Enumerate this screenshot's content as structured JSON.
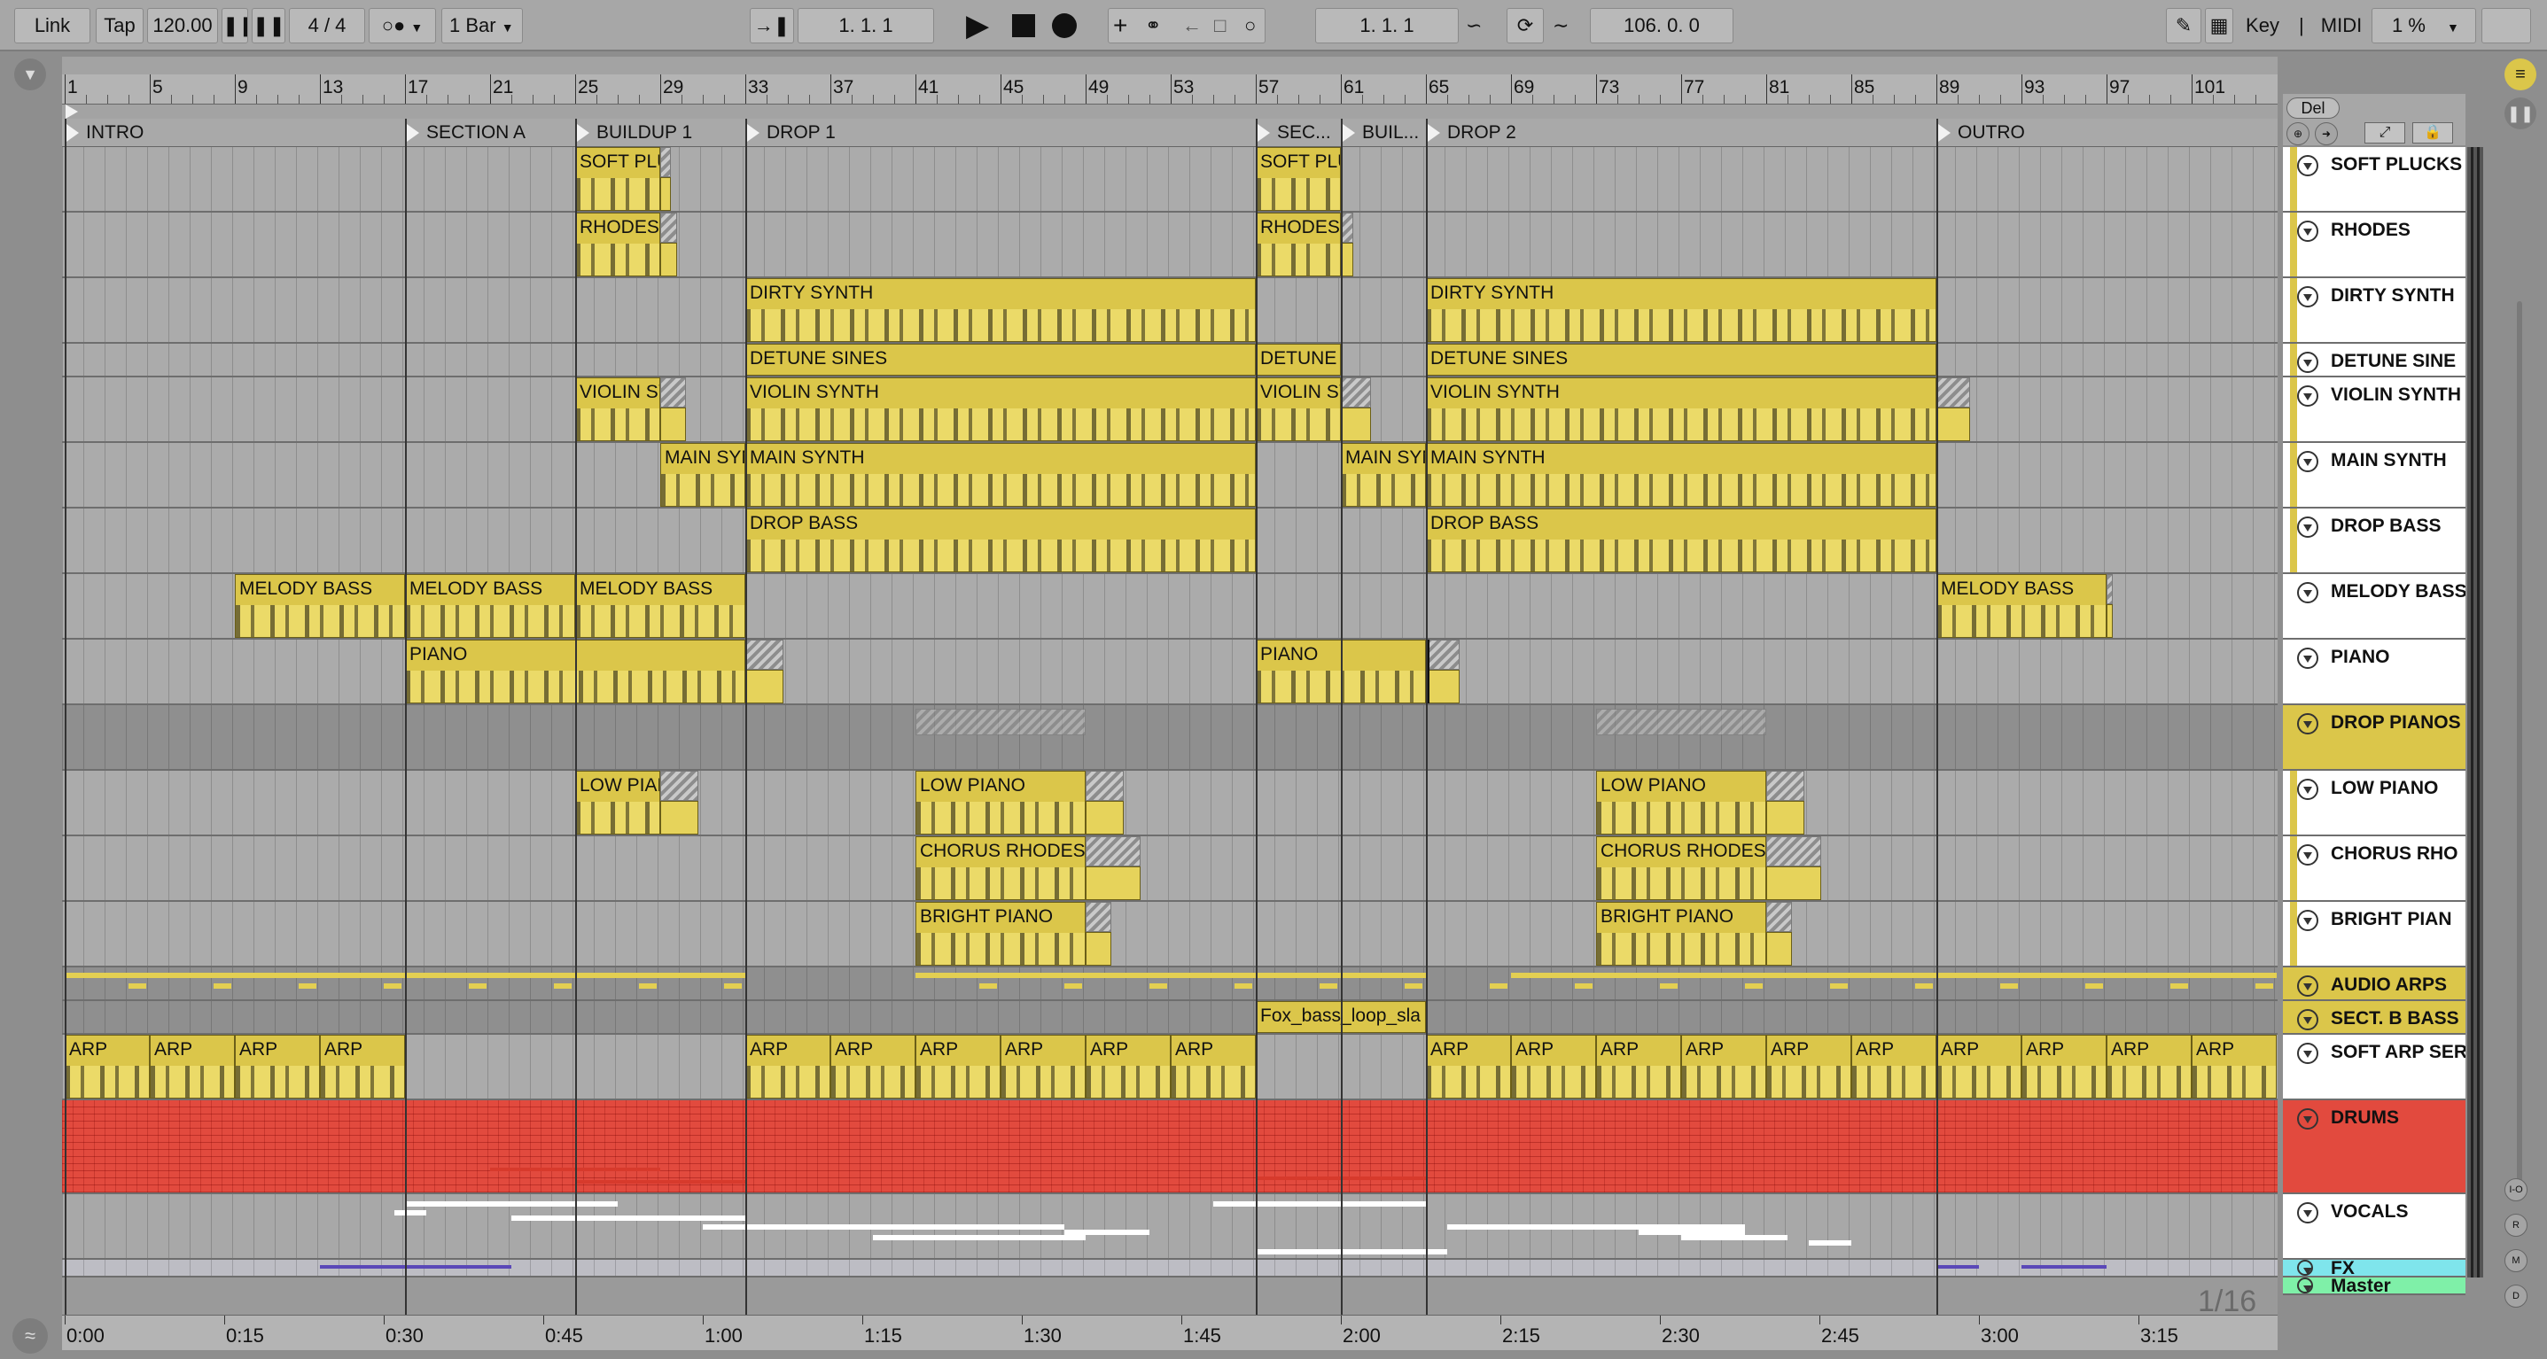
{
  "toolbar": {
    "link": "Link",
    "tap": "Tap",
    "tempo": "120.00",
    "signature": "4 / 4",
    "quantize": "1 Bar",
    "arrangement_position": "1.   1.   1",
    "loop_start": "1.   1.   1",
    "loop_length": "106.   0.   0",
    "key": "Key",
    "midi": "MIDI",
    "cpu": "1 %"
  },
  "del_label": "Del",
  "ruler": {
    "bars": [
      "1",
      "5",
      "9",
      "13",
      "17",
      "21",
      "25",
      "29",
      "33",
      "37",
      "41",
      "45",
      "49",
      "53",
      "57",
      "61",
      "65",
      "69",
      "73",
      "77",
      "81",
      "85",
      "89",
      "93",
      "97",
      "101"
    ]
  },
  "locators": [
    {
      "name": "INTRO",
      "bar": 1
    },
    {
      "name": "SECTION A",
      "bar": 17
    },
    {
      "name": "BUILDUP 1",
      "bar": 25
    },
    {
      "name": "DROP 1",
      "bar": 33
    },
    {
      "name": "SEC...",
      "bar": 57
    },
    {
      "name": "BUIL...",
      "bar": 61
    },
    {
      "name": "DROP 2",
      "bar": 65
    },
    {
      "name": "OUTRO",
      "bar": 89
    }
  ],
  "tracks": [
    {
      "name": "SOFT PLUCKS",
      "kind": "midi",
      "clips": [
        {
          "label": "SOFT PLU",
          "start": 25,
          "end": 29,
          "tail": 29.5
        },
        {
          "label": "SOFT PLU",
          "start": 57,
          "end": 61
        }
      ]
    },
    {
      "name": "RHODES",
      "kind": "midi",
      "clips": [
        {
          "label": "RHODES",
          "start": 25,
          "end": 29,
          "tail": 29.8
        },
        {
          "label": "RHODES",
          "start": 57,
          "end": 61,
          "tail": 61.6
        }
      ]
    },
    {
      "name": "DIRTY SYNTH",
      "kind": "midi",
      "clips": [
        {
          "label": "DIRTY SYNTH",
          "start": 33,
          "end": 57
        },
        {
          "label": "DIRTY SYNTH",
          "start": 65,
          "end": 89
        }
      ]
    },
    {
      "name": "DETUNE SINE",
      "kind": "midi",
      "clips": [
        {
          "label": "DETUNE SINES",
          "start": 33,
          "end": 57
        },
        {
          "label": "DETUNE S",
          "start": 57,
          "end": 61
        },
        {
          "label": "DETUNE SINES",
          "start": 65,
          "end": 89
        }
      ]
    },
    {
      "name": "VIOLIN SYNTH",
      "kind": "midi",
      "clips": [
        {
          "label": "VIOLIN SY",
          "start": 25,
          "end": 29,
          "tail": 30.2
        },
        {
          "label": "VIOLIN SYNTH",
          "start": 33,
          "end": 57
        },
        {
          "label": "VIOLIN SY",
          "start": 57,
          "end": 61,
          "tail": 62.4
        },
        {
          "label": "VIOLIN SYNTH",
          "start": 65,
          "end": 89,
          "tail": 90.6
        }
      ]
    },
    {
      "name": "MAIN SYNTH",
      "kind": "midi",
      "clips": [
        {
          "label": "MAIN SYN",
          "start": 29,
          "end": 33
        },
        {
          "label": "MAIN SYNTH",
          "start": 33,
          "end": 57
        },
        {
          "label": "MAIN SYN",
          "start": 61,
          "end": 65
        },
        {
          "label": "MAIN SYNTH",
          "start": 65,
          "end": 89
        }
      ]
    },
    {
      "name": "DROP BASS",
      "kind": "midi",
      "clips": [
        {
          "label": "DROP BASS",
          "start": 33,
          "end": 57
        },
        {
          "label": "DROP BASS",
          "start": 65,
          "end": 89
        }
      ]
    },
    {
      "name": "MELODY BASS",
      "kind": "midi",
      "clips": [
        {
          "label": "MELODY BASS",
          "start": 9,
          "end": 17
        },
        {
          "label": "MELODY BASS",
          "start": 17,
          "end": 25
        },
        {
          "label": "MELODY BASS",
          "start": 25,
          "end": 33
        },
        {
          "label": "MELODY BASS",
          "start": 89,
          "end": 97,
          "tail": 97.3
        }
      ]
    },
    {
      "name": "PIANO",
      "kind": "midi",
      "clips": [
        {
          "label": "PIANO",
          "start": 17,
          "end": 33,
          "tail": 34.8
        },
        {
          "label": "PIANO",
          "start": 57,
          "end": 65,
          "tail": 66.6
        }
      ]
    },
    {
      "name": "DROP PIANOS",
      "kind": "group",
      "clips": []
    },
    {
      "name": "LOW PIANO",
      "kind": "midi",
      "clips": [
        {
          "label": "LOW PIAN",
          "start": 25,
          "end": 29,
          "tail": 30.8
        },
        {
          "label": "LOW PIANO",
          "start": 41,
          "end": 49,
          "tail": 50.8
        },
        {
          "label": "LOW PIANO",
          "start": 73,
          "end": 81,
          "tail": 82.8
        }
      ]
    },
    {
      "name": "CHORUS RHO",
      "kind": "midi",
      "clips": [
        {
          "label": "CHORUS RHODES",
          "start": 41,
          "end": 49,
          "tail": 51.6
        },
        {
          "label": "CHORUS RHODES",
          "start": 73,
          "end": 81,
          "tail": 83.6
        }
      ]
    },
    {
      "name": "BRIGHT PIAN",
      "kind": "midi",
      "clips": [
        {
          "label": "BRIGHT PIANO",
          "start": 41,
          "end": 49,
          "tail": 50.2
        },
        {
          "label": "BRIGHT PIANO",
          "start": 73,
          "end": 81,
          "tail": 82.2
        }
      ]
    },
    {
      "name": "AUDIO ARPS",
      "kind": "audio",
      "clips": []
    },
    {
      "name": "SECT. B BASS",
      "kind": "audio",
      "clips": [
        {
          "label": "Fox_bass_loop_sla",
          "start": 57,
          "end": 65
        }
      ]
    },
    {
      "name": "SOFT ARP SER",
      "kind": "midi",
      "clips": [
        {
          "label": "ARP",
          "start": 1,
          "end": 5
        },
        {
          "label": "ARP",
          "start": 5,
          "end": 9
        },
        {
          "label": "ARP",
          "start": 9,
          "end": 13
        },
        {
          "label": "ARP",
          "start": 13,
          "end": 17
        },
        {
          "label": "ARP",
          "start": 33,
          "end": 37
        },
        {
          "label": "ARP",
          "start": 37,
          "end": 41
        },
        {
          "label": "ARP",
          "start": 41,
          "end": 45
        },
        {
          "label": "ARP",
          "start": 45,
          "end": 49
        },
        {
          "label": "ARP",
          "start": 49,
          "end": 53
        },
        {
          "label": "ARP",
          "start": 53,
          "end": 57
        },
        {
          "label": "ARP",
          "start": 65,
          "end": 69
        },
        {
          "label": "ARP",
          "start": 69,
          "end": 73
        },
        {
          "label": "ARP",
          "start": 73,
          "end": 77
        },
        {
          "label": "ARP",
          "start": 77,
          "end": 81
        },
        {
          "label": "ARP",
          "start": 81,
          "end": 85
        },
        {
          "label": "ARP",
          "start": 85,
          "end": 89
        },
        {
          "label": "ARP",
          "start": 89,
          "end": 93
        },
        {
          "label": "ARP",
          "start": 93,
          "end": 97
        },
        {
          "label": "ARP",
          "start": 97,
          "end": 101
        },
        {
          "label": "ARP",
          "start": 101,
          "end": 105
        }
      ]
    },
    {
      "name": "DRUMS",
      "kind": "drums",
      "clips": []
    },
    {
      "name": "VOCALS",
      "kind": "vocals",
      "clips": []
    },
    {
      "name": "FX",
      "kind": "fx",
      "clips": []
    },
    {
      "name": "Master",
      "kind": "master",
      "clips": []
    }
  ],
  "timeline": {
    "labels": [
      "0:00",
      "0:15",
      "0:30",
      "0:45",
      "1:00",
      "1:15",
      "1:30",
      "1:45",
      "2:00",
      "2:15",
      "2:30",
      "2:45",
      "3:00",
      "3:15"
    ]
  },
  "grid_label": "1/16",
  "side_buttons": [
    "I-O",
    "R",
    "M",
    "D"
  ],
  "colors": {
    "clip": "#e6d35b",
    "drums": "#e24a3e",
    "fx": "#7fe5ec",
    "master": "#7ff0a8"
  }
}
